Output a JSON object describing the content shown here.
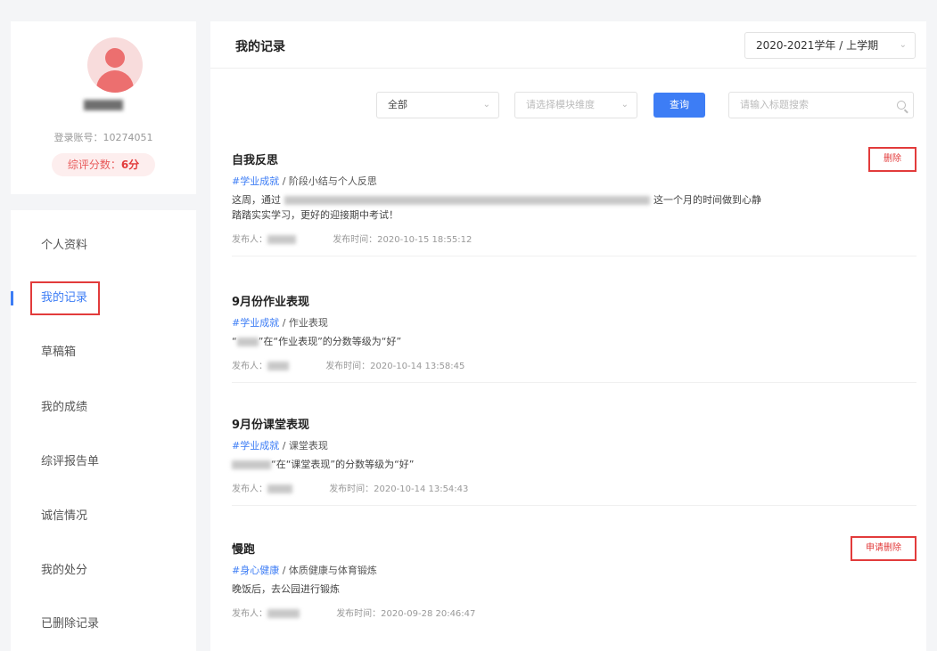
{
  "profile": {
    "account_label": "登录账号：10274051",
    "score_label": "综评分数：",
    "score_value": "6分"
  },
  "nav": {
    "items": [
      {
        "label": "个人资料"
      },
      {
        "label": "我的记录"
      },
      {
        "label": "草稿箱"
      },
      {
        "label": "我的成绩"
      },
      {
        "label": "综评报告单"
      },
      {
        "label": "诚信情况"
      },
      {
        "label": "我的处分"
      },
      {
        "label": "已删除记录"
      }
    ],
    "active_index": 1
  },
  "main": {
    "title": "我的记录",
    "term_select": "2020-2021学年 / 上学期",
    "filters": {
      "category": "全部",
      "module_placeholder": "请选择模块维度",
      "query_button": "查询",
      "search_placeholder": "请输入标题搜索"
    },
    "records": [
      {
        "title": "自我反思",
        "tag": "#学业成就",
        "subtag": " / 阶段小结与个人反思",
        "body_line1a": "这周，通过",
        "body_line1b": "这一个月的时间做到心静",
        "body_line2": "踏踏实实学习，更好的迎接期中考试！",
        "publisher_label": "发布人：",
        "time": "发布时间：2020-10-15 18:55:12",
        "action": "删除"
      },
      {
        "title": "9月份作业表现",
        "tag": "#学业成就",
        "subtag": " / 作业表现",
        "body_line1a": "“",
        "body_line1b": "”在“作业表现”的分数等级为“好”",
        "publisher_label": "发布人：",
        "time": "发布时间：2020-10-14 13:58:45"
      },
      {
        "title": "9月份课堂表现",
        "tag": "#学业成就",
        "subtag": " / 课堂表现",
        "body_line1a": "",
        "body_line1b": "“在“课堂表现”的分数等级为“好”",
        "publisher_label": "发布人：",
        "time": "发布时间：2020-10-14 13:54:43"
      },
      {
        "title": "慢跑",
        "tag": "#身心健康",
        "subtag": " / 体质健康与体育锻炼",
        "body_line1a": "晚饭后，去公园进行锻炼",
        "body_line1b": "",
        "publisher_label": "发布人：",
        "time": "发布时间：2020-09-28 20:46:47",
        "action": "申请删除"
      }
    ]
  }
}
